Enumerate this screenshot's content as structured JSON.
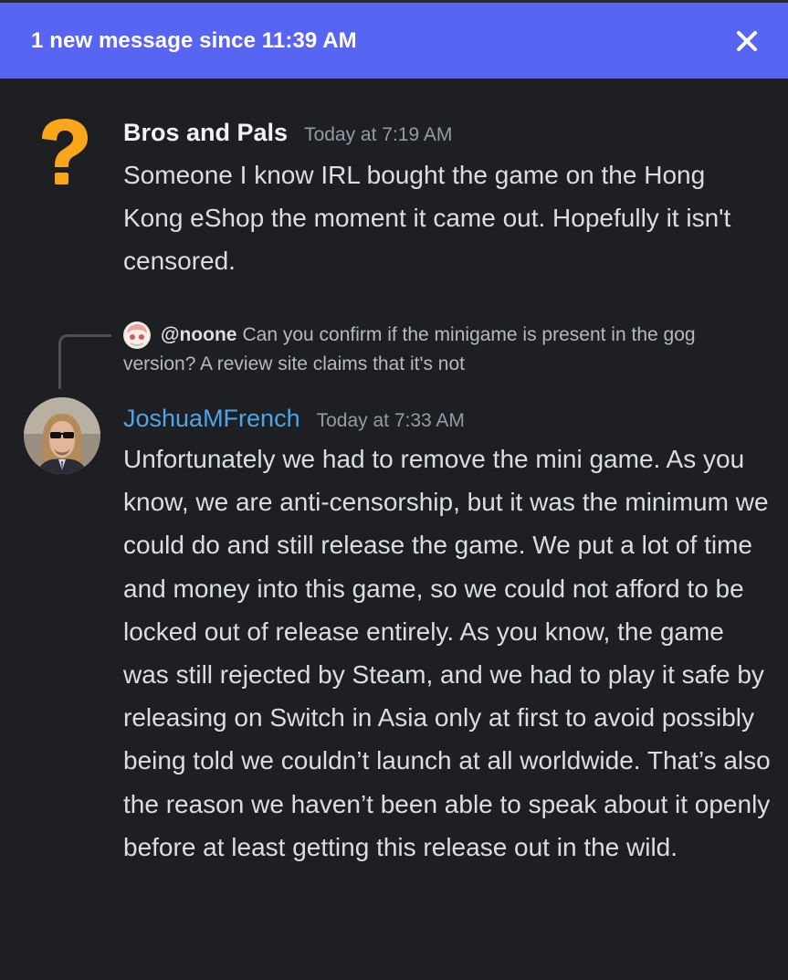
{
  "banner": {
    "text": "1 new message since 11:39 AM",
    "close_icon": "close-x-icon",
    "color": "#5865f2"
  },
  "messages": [
    {
      "author": "Bros and Pals",
      "timestamp": "Today at 7:19 AM",
      "avatar_icon": "question-mark-icon",
      "author_color": "#f2f3f5",
      "body": "Someone I know IRL bought the game on the Hong Kong eShop the moment it came out. Hopefully it isn't censored."
    },
    {
      "reply": {
        "user": "@noone",
        "text": "Can you confirm if the minigame is present in the gog version? A review site claims that it's not"
      },
      "author": "JoshuaMFrench",
      "timestamp": "Today at 7:33 AM",
      "author_color": "#4ea4e8",
      "body": "Unfortunately we had to remove the mini game. As you know, we are anti-censorship, but it was the minimum we could do and still release the game. We put a lot of time and money into this game, so we could not afford to be locked out of release entirely. As you know, the game was still rejected by Steam, and we had to play it safe by releasing on Switch in Asia only at first to avoid possibly being told we couldn’t launch at all worldwide. That’s also the reason we haven’t been able to speak about it openly before at least getting this release out in the wild."
    }
  ]
}
